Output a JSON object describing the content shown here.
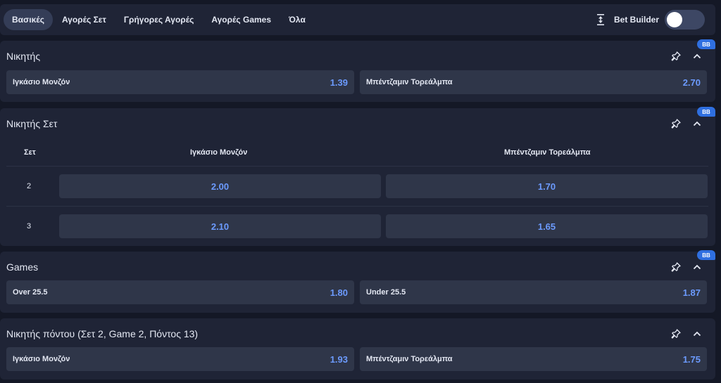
{
  "tabs": [
    {
      "label": "Βασικές",
      "active": true
    },
    {
      "label": "Αγορές Σετ",
      "active": false
    },
    {
      "label": "Γρήγορες Αγορές",
      "active": false
    },
    {
      "label": "Αγορές Games",
      "active": false
    },
    {
      "label": "Όλα",
      "active": false
    }
  ],
  "bet_builder": {
    "label": "Bet Builder",
    "enabled": false
  },
  "badge_label": "BB",
  "icons": {
    "pin": "pin-icon",
    "collapse": "chevron-up-icon",
    "bet_builder": "expand-vertical-icon"
  },
  "colors": {
    "odds": "#6c9bff",
    "badge": "#2f6fe0",
    "active_tab": "#343d57"
  },
  "markets": {
    "winner": {
      "title": "Νικητής",
      "options": [
        {
          "name": "Ιγκάσιο Μονζόν",
          "odds": "1.39"
        },
        {
          "name": "Μπέντζαμιν Τορεάλμπα",
          "odds": "2.70"
        }
      ]
    },
    "set_winner": {
      "title": "Νικητής Σετ",
      "columns": {
        "set": "Σετ",
        "player1": "Ιγκάσιο Μονζόν",
        "player2": "Μπέντζαμιν Τορεάλμπα"
      },
      "rows": [
        {
          "set": "2",
          "odds1": "2.00",
          "odds2": "1.70"
        },
        {
          "set": "3",
          "odds1": "2.10",
          "odds2": "1.65"
        }
      ]
    },
    "games": {
      "title": "Games",
      "options": [
        {
          "name": "Over 25.5",
          "odds": "1.80"
        },
        {
          "name": "Under 25.5",
          "odds": "1.87"
        }
      ]
    },
    "point_winner": {
      "title": "Νικητής πόντου (Σετ 2, Game 2, Πόντος 13)",
      "options": [
        {
          "name": "Ιγκάσιο Μονζόν",
          "odds": "1.93"
        },
        {
          "name": "Μπέντζαμιν Τορεάλμπα",
          "odds": "1.75"
        }
      ]
    }
  }
}
